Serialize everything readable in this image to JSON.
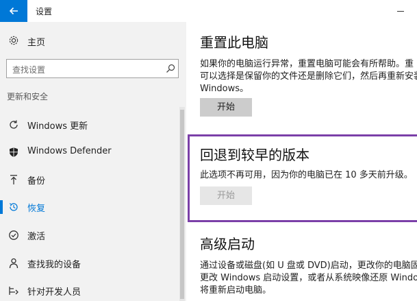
{
  "window": {
    "title": "设置"
  },
  "sidebar": {
    "home_label": "主页",
    "search_placeholder": "查找设置",
    "section_heading": "更新和安全",
    "items": [
      {
        "label": "Windows 更新",
        "icon": "refresh-icon"
      },
      {
        "label": "Windows Defender",
        "icon": "shield-icon"
      },
      {
        "label": "备份",
        "icon": "upload-arrow-icon"
      },
      {
        "label": "恢复",
        "icon": "history-icon",
        "active": true
      },
      {
        "label": "激活",
        "icon": "check-circle-icon"
      },
      {
        "label": "查找我的设备",
        "icon": "person-icon"
      },
      {
        "label": "针对开发人员",
        "icon": "developer-icon"
      }
    ]
  },
  "main": {
    "reset": {
      "title": "重置此电脑",
      "lines": [
        "如果你的电脑运行异常，重置电脑可能会有所帮助。重",
        "可以选择是保留你的文件还是删除它们，然后再重新安装",
        "Windows。"
      ],
      "button": "开始"
    },
    "rollback": {
      "title": "回退到较早的版本",
      "text": "此选项不再可用，因为你的电脑已在 10 多天前升级。",
      "button": "开始"
    },
    "advanced": {
      "title": "高级启动",
      "lines": [
        "通过设备或磁盘(如 U 盘或 DVD)启动，更改你的电脑固件",
        "更改 Windows 启动设置，或者从系统映像还原 Windows",
        "将重新启动电脑。"
      ]
    }
  },
  "colors": {
    "accent": "#0078d7",
    "highlight_border": "#7b3fa8",
    "sidebar_bg": "#f2f2f2"
  }
}
